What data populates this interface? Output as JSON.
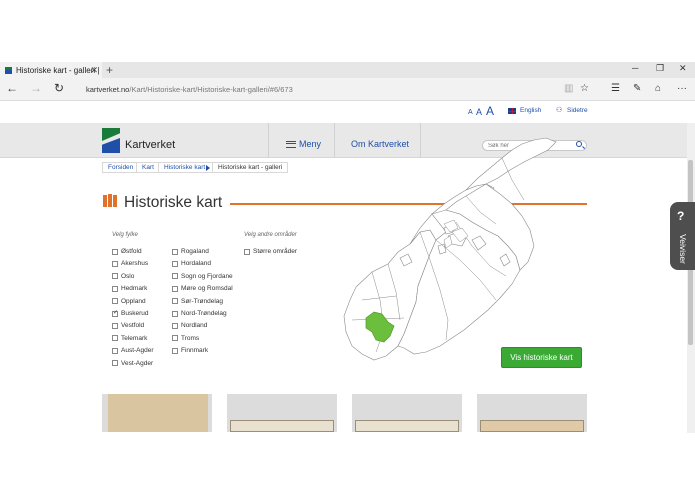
{
  "browser": {
    "tab_title": "Historiske kart - galleri |",
    "url_host": "kartverket.no",
    "url_path": "/Kart/Historiske-kart/Historiske-kart-galleri/#6/673",
    "new_tab": "+",
    "close": "✕",
    "minimize": "─",
    "maximize": "❐",
    "win_close": "✕",
    "back": "←",
    "forward": "→",
    "reload": "↻",
    "reading": "▥",
    "favorite": "☆",
    "hub": "☰",
    "notes": "✎",
    "share": "⌂",
    "more": "···"
  },
  "site": {
    "font_a_small": "A",
    "font_a_medium": "A",
    "font_a_large": "A",
    "english": "English",
    "sidetre": "Sidetre",
    "brand": "Kartverket",
    "menu": "Meny",
    "about": "Om Kartverket",
    "search_placeholder": "Søk her"
  },
  "breadcrumb": [
    "Forsiden",
    "Kart",
    "Historiske kart",
    "Historiske kart - galleri"
  ],
  "page": {
    "title": "Historiske kart",
    "county_label": "Velg fylke",
    "other_label": "Velg andre områder",
    "button": "Vis historiske kart"
  },
  "counties_col1": [
    {
      "label": "Østfold",
      "checked": false
    },
    {
      "label": "Akershus",
      "checked": false
    },
    {
      "label": "Oslo",
      "checked": false
    },
    {
      "label": "Hedmark",
      "checked": false
    },
    {
      "label": "Oppland",
      "checked": false
    },
    {
      "label": "Buskerud",
      "checked": true
    },
    {
      "label": "Vestfold",
      "checked": false
    },
    {
      "label": "Telemark",
      "checked": false
    },
    {
      "label": "Aust-Agder",
      "checked": false
    },
    {
      "label": "Vest-Agder",
      "checked": false
    }
  ],
  "counties_col2": [
    {
      "label": "Rogaland",
      "checked": false
    },
    {
      "label": "Hordaland",
      "checked": false
    },
    {
      "label": "Sogn og Fjordane",
      "checked": false
    },
    {
      "label": "Møre og Romsdal",
      "checked": false
    },
    {
      "label": "Sør-Trøndelag",
      "checked": false
    },
    {
      "label": "Nord-Trøndelag",
      "checked": false
    },
    {
      "label": "Nordland",
      "checked": false
    },
    {
      "label": "Troms",
      "checked": false
    },
    {
      "label": "Finnmark",
      "checked": false
    }
  ],
  "other_areas": [
    {
      "label": "Større områder",
      "checked": false
    }
  ],
  "veiviser": {
    "icon": "?",
    "label": "Veiviser"
  },
  "colors": {
    "accent": "#e0722b",
    "link": "#1f4fa8",
    "button": "#3aaa35",
    "highlight": "#6cbf3c"
  }
}
